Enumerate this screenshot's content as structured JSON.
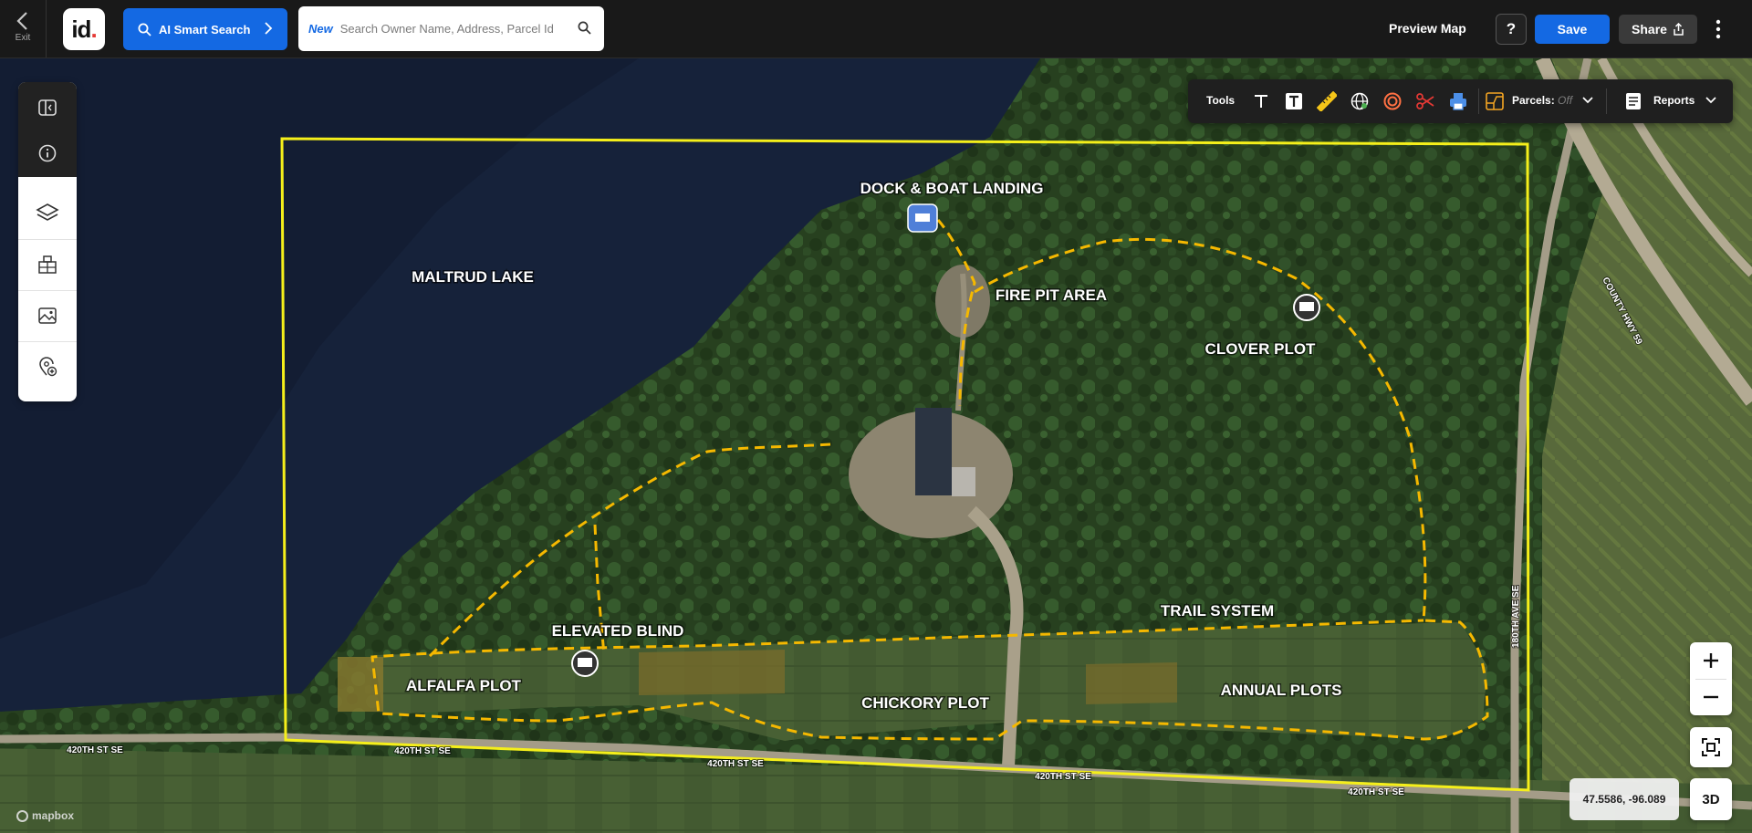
{
  "topbar": {
    "exit_label": "Exit",
    "logo_text": "id",
    "ai_search_label": "AI Smart Search",
    "search_badge": "New",
    "search_placeholder": "Search Owner Name, Address, Parcel Id",
    "preview_label": "Preview Map",
    "help_label": "?",
    "save_label": "Save",
    "share_label": "Share"
  },
  "tools": {
    "label": "Tools",
    "items": [
      "text-icon",
      "text-box-icon",
      "ruler-icon",
      "globe-icon",
      "radius-icon",
      "scissors-icon",
      "print-icon"
    ],
    "parcels_label": "Parcels:",
    "parcels_state": "Off",
    "reports_label": "Reports"
  },
  "sidebar": {
    "items": [
      "collapse-panel-icon",
      "info-icon",
      "layers-icon",
      "buildings-icon",
      "image-icon",
      "add-location-icon"
    ]
  },
  "map": {
    "boundary_color": "#f5ef1a",
    "trail_color": "#f5b800",
    "labels": {
      "lake": "MALTRUD LAKE",
      "dock": "DOCK & BOAT LANDING",
      "firepit": "FIRE PIT AREA",
      "clover": "CLOVER PLOT",
      "blind": "ELEVATED BLIND",
      "alfalfa": "ALFALFA PLOT",
      "chickory": "CHICKORY PLOT",
      "trail": "TRAIL SYSTEM",
      "annual": "ANNUAL PLOTS"
    },
    "roads": {
      "r420a": "420TH ST SE",
      "r420b": "420TH ST SE",
      "r420c": "420TH ST SE",
      "r420d": "420TH ST SE",
      "r420e": "420TH ST SE",
      "r180": "180TH AVE SE",
      "county": "COUNTY HWY 59"
    },
    "coordinates": "47.5586, -96.089",
    "zoom_in": "+",
    "zoom_out": "−",
    "three_d": "3D",
    "attribution": "mapbox"
  }
}
